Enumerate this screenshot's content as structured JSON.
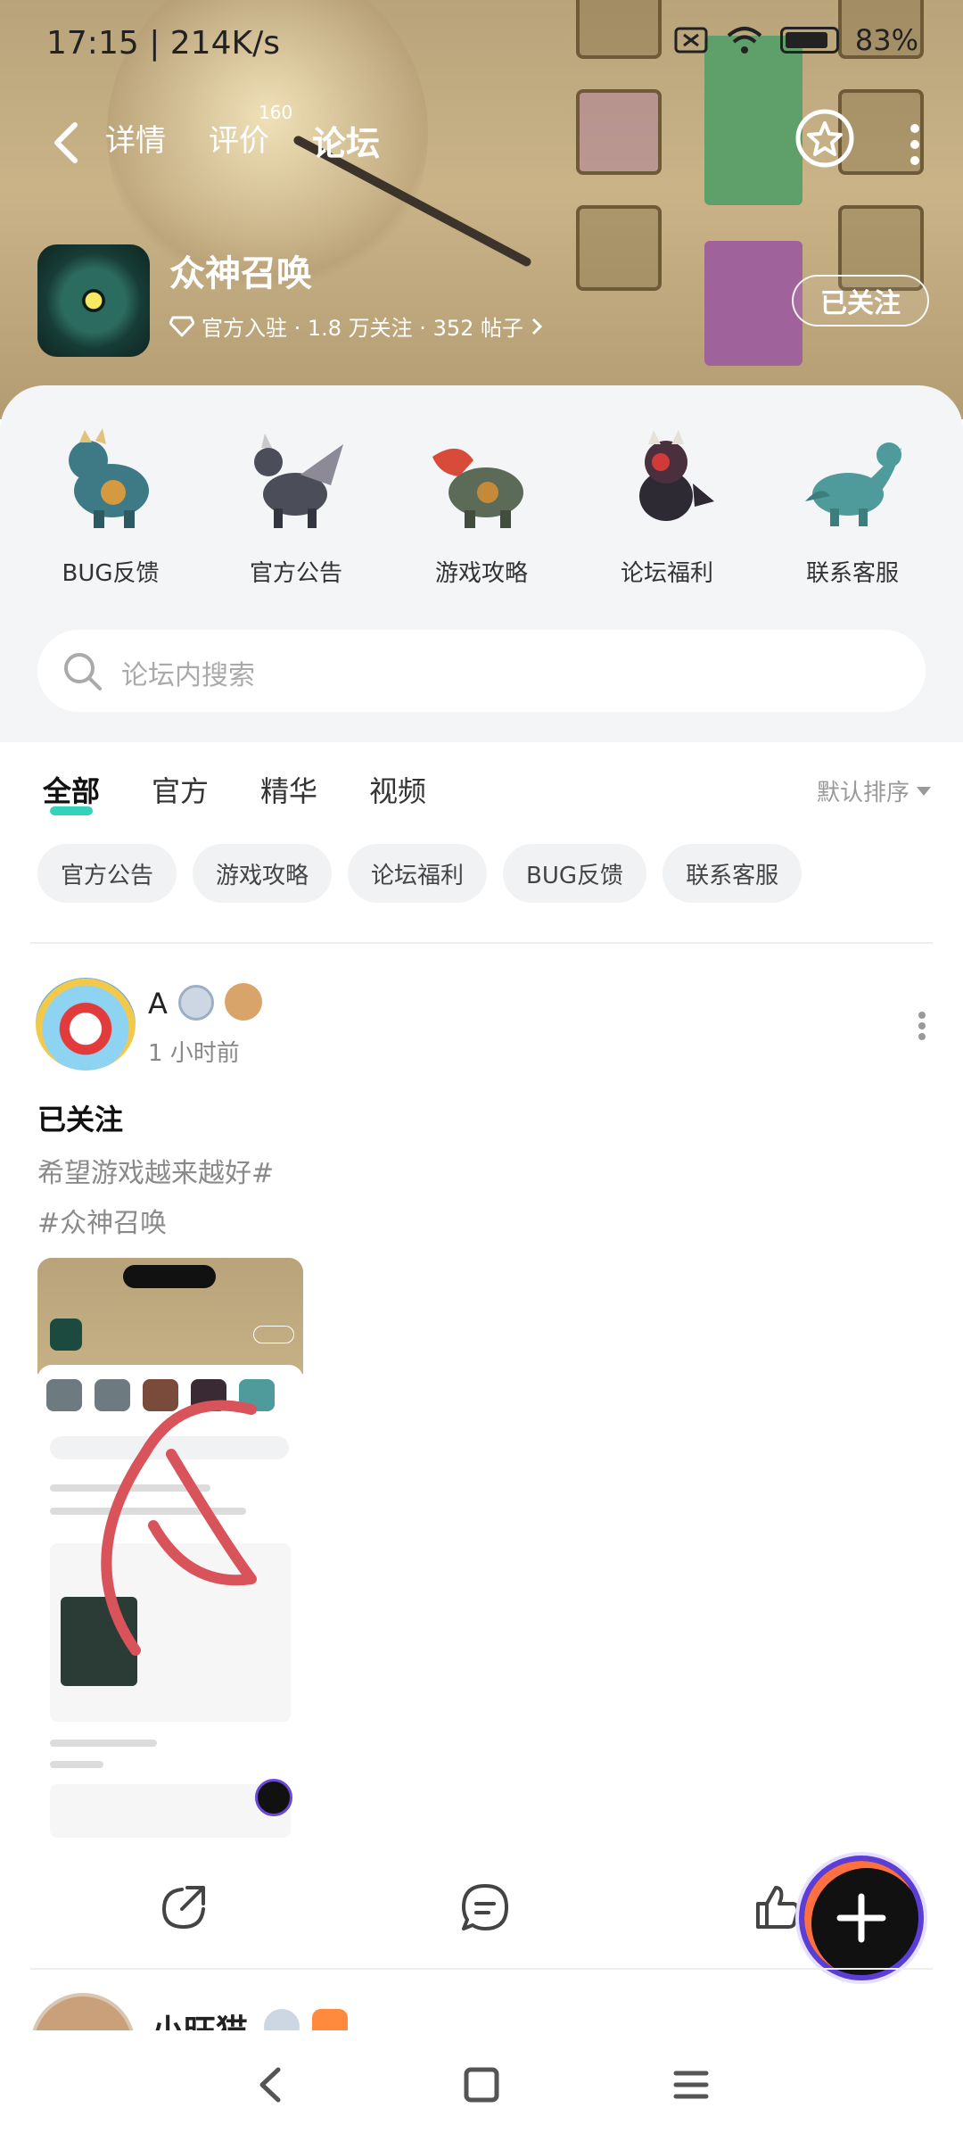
{
  "status_bar": {
    "time": "17:15 | 214K/s",
    "battery": "83%"
  },
  "nav": {
    "tabs": [
      {
        "label": "详情"
      },
      {
        "label": "评价"
      },
      {
        "label": "论坛"
      }
    ],
    "review_count": "160"
  },
  "game": {
    "title": "众神召唤",
    "meta": "官方入驻 · 1.8 万关注 · 352 帖子",
    "follow_label": "已关注"
  },
  "categories": [
    {
      "label": "BUG反馈",
      "icon": "dragon-blue-icon"
    },
    {
      "label": "官方公告",
      "icon": "dragon-dark-icon"
    },
    {
      "label": "游戏攻略",
      "icon": "dragon-red-icon"
    },
    {
      "label": "论坛福利",
      "icon": "dragon-purple-icon"
    },
    {
      "label": "联系客服",
      "icon": "dragon-teal-icon"
    }
  ],
  "search": {
    "placeholder": "论坛内搜索"
  },
  "filter_tabs": [
    {
      "label": "全部"
    },
    {
      "label": "官方"
    },
    {
      "label": "精华"
    },
    {
      "label": "视频"
    }
  ],
  "sort_label": "默认排序",
  "chips": [
    {
      "label": "官方公告"
    },
    {
      "label": "游戏攻略"
    },
    {
      "label": "论坛福利"
    },
    {
      "label": "BUG反馈"
    },
    {
      "label": "联系客服"
    }
  ],
  "post": {
    "author": "A",
    "time": "1 小时前",
    "title": "已关注",
    "body_line1": "希望游戏越来越好#",
    "body_line2": "#众神召唤"
  },
  "post2": {
    "author": "小旺猫"
  },
  "colors": {
    "accent": "#32d3b8",
    "fab_ring": "#5a3ed6"
  }
}
